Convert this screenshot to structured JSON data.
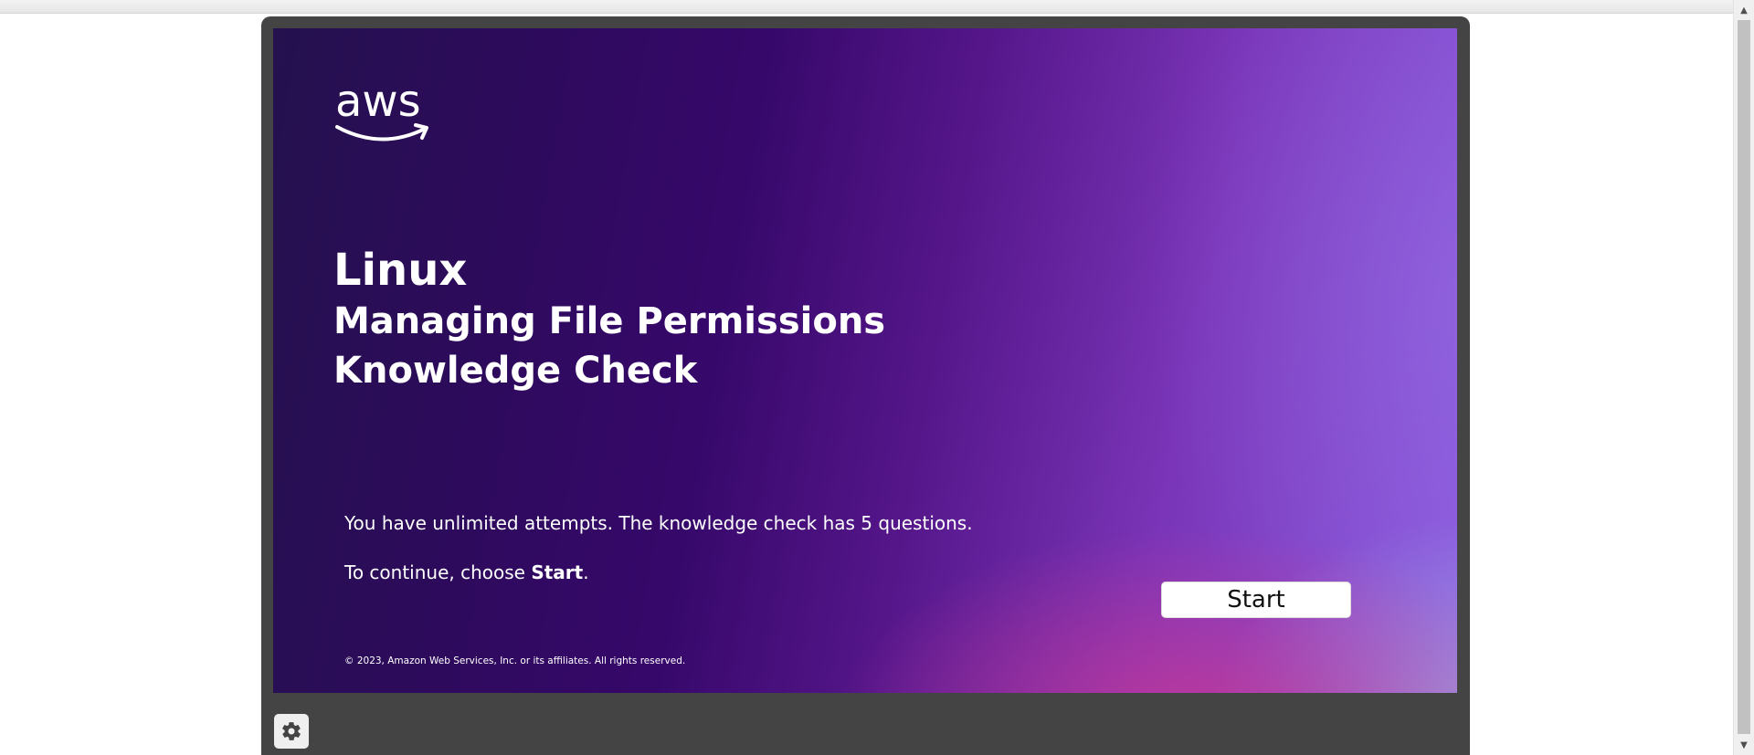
{
  "slide": {
    "logo_text": "aws",
    "title_line1": "Linux",
    "title_line2": "Managing File Permissions",
    "title_line3": "Knowledge Check",
    "attempts_text": "You have unlimited attempts. The knowledge check has 5 questions.",
    "continue_prefix": "To continue, choose ",
    "continue_bold": "Start",
    "continue_suffix": ".",
    "start_button_label": "Start",
    "copyright": "© 2023, Amazon Web Services, Inc. or its affiliates. All rights reserved."
  },
  "player": {
    "settings_icon": "gear-icon"
  },
  "colors": {
    "player_frame": "#444444",
    "slide_dark": "#2e0a5d",
    "slide_accent": "#8a5ae0",
    "slide_pink": "#c73796",
    "button_bg": "#ffffff"
  }
}
